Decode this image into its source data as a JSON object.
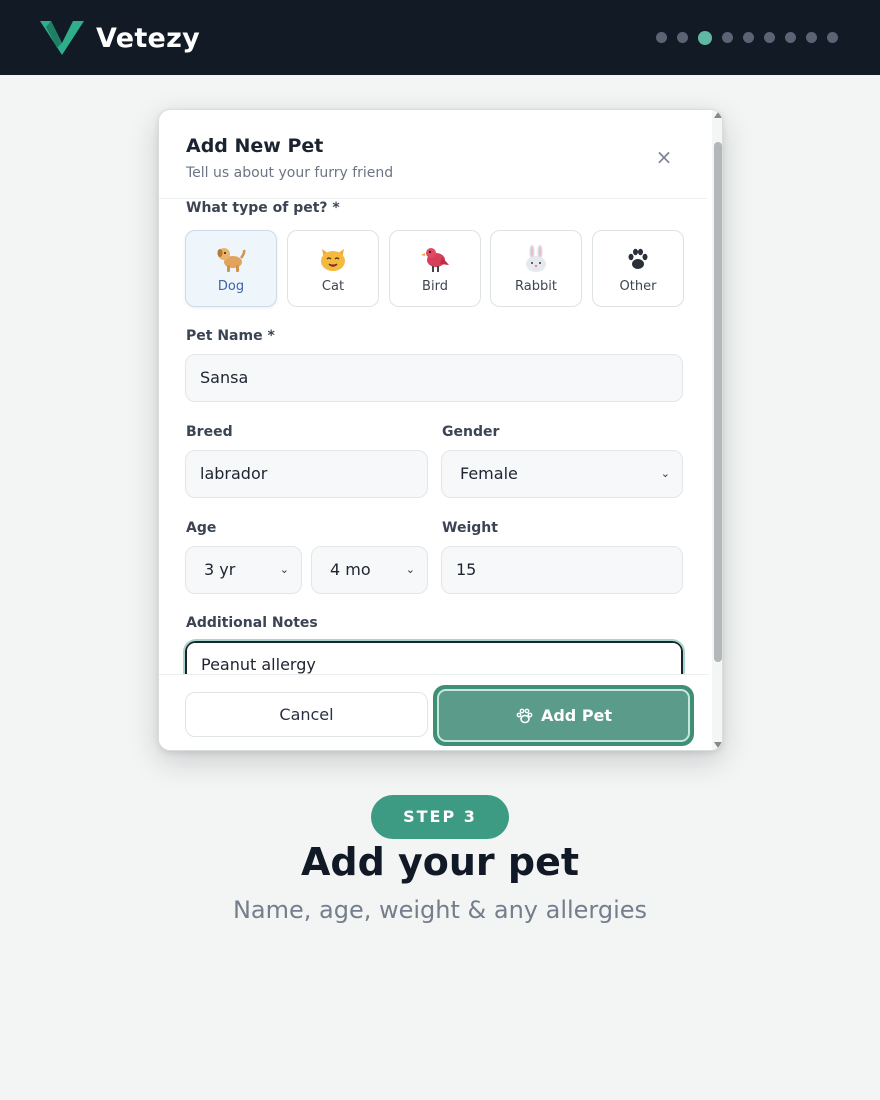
{
  "app": {
    "name": "Vetezy"
  },
  "progress": {
    "total_steps": 9,
    "current_step": 3
  },
  "modal": {
    "title": "Add New Pet",
    "subtitle": "Tell us about your furry friend",
    "close_label": "×",
    "pet_type_label": "What type of pet? *",
    "pet_types": [
      {
        "label": "Dog",
        "icon": "dog-icon",
        "selected": true
      },
      {
        "label": "Cat",
        "icon": "cat-icon",
        "selected": false
      },
      {
        "label": "Bird",
        "icon": "bird-icon",
        "selected": false
      },
      {
        "label": "Rabbit",
        "icon": "rabbit-icon",
        "selected": false
      },
      {
        "label": "Other",
        "icon": "paw-icon",
        "selected": false
      }
    ],
    "pet_name": {
      "label": "Pet Name *",
      "value": "Sansa"
    },
    "breed": {
      "label": "Breed",
      "value": "labrador"
    },
    "gender": {
      "label": "Gender",
      "value": "Female"
    },
    "age": {
      "label": "Age",
      "years": "3 yr",
      "months": "4 mo"
    },
    "weight": {
      "label": "Weight",
      "value": "15"
    },
    "notes": {
      "label": "Additional Notes",
      "value": "Peanut allergy"
    },
    "cancel_label": "Cancel",
    "add_label": "Add Pet"
  },
  "step": {
    "badge": "STEP 3",
    "title": "Add your pet",
    "subtitle": "Name, age, weight & any allergies"
  },
  "colors": {
    "topbar": "#121a26",
    "accent": "#3d9b83",
    "button": "#5a9c89",
    "background": "#f3f5f4"
  }
}
